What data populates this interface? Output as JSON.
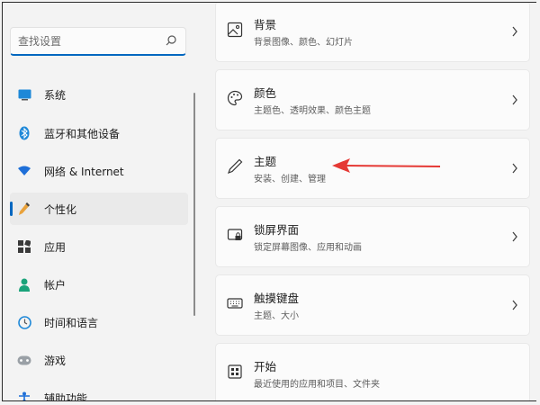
{
  "search": {
    "placeholder": "查找设置"
  },
  "nav": {
    "items": [
      {
        "label": "系统",
        "icon": "monitor-icon"
      },
      {
        "label": "蓝牙和其他设备",
        "icon": "bluetooth-icon"
      },
      {
        "label": "网络 & Internet",
        "icon": "wifi-icon"
      },
      {
        "label": "个性化",
        "icon": "pen-icon",
        "active": true
      },
      {
        "label": "应用",
        "icon": "apps-icon"
      },
      {
        "label": "帐户",
        "icon": "person-icon"
      },
      {
        "label": "时间和语言",
        "icon": "globe-clock-icon"
      },
      {
        "label": "游戏",
        "icon": "gamepad-icon"
      },
      {
        "label": "辅助功能",
        "icon": "accessibility-icon"
      }
    ]
  },
  "cards": [
    {
      "title": "背景",
      "subtitle": "背景图像、颜色、幻灯片",
      "icon": "image-icon"
    },
    {
      "title": "颜色",
      "subtitle": "主题色、透明效果、颜色主题",
      "icon": "palette-icon"
    },
    {
      "title": "主题",
      "subtitle": "安装、创建、管理",
      "icon": "brush-icon"
    },
    {
      "title": "锁屏界面",
      "subtitle": "锁定屏幕图像、应用和动画",
      "icon": "lock-screen-icon"
    },
    {
      "title": "触摸键盘",
      "subtitle": "主题、大小",
      "icon": "keyboard-icon"
    },
    {
      "title": "开始",
      "subtitle": "最近使用的应用和项目、文件夹",
      "icon": "start-icon"
    }
  ],
  "colors": {
    "accent": "#0067c0",
    "annotation_arrow": "#e53935"
  }
}
